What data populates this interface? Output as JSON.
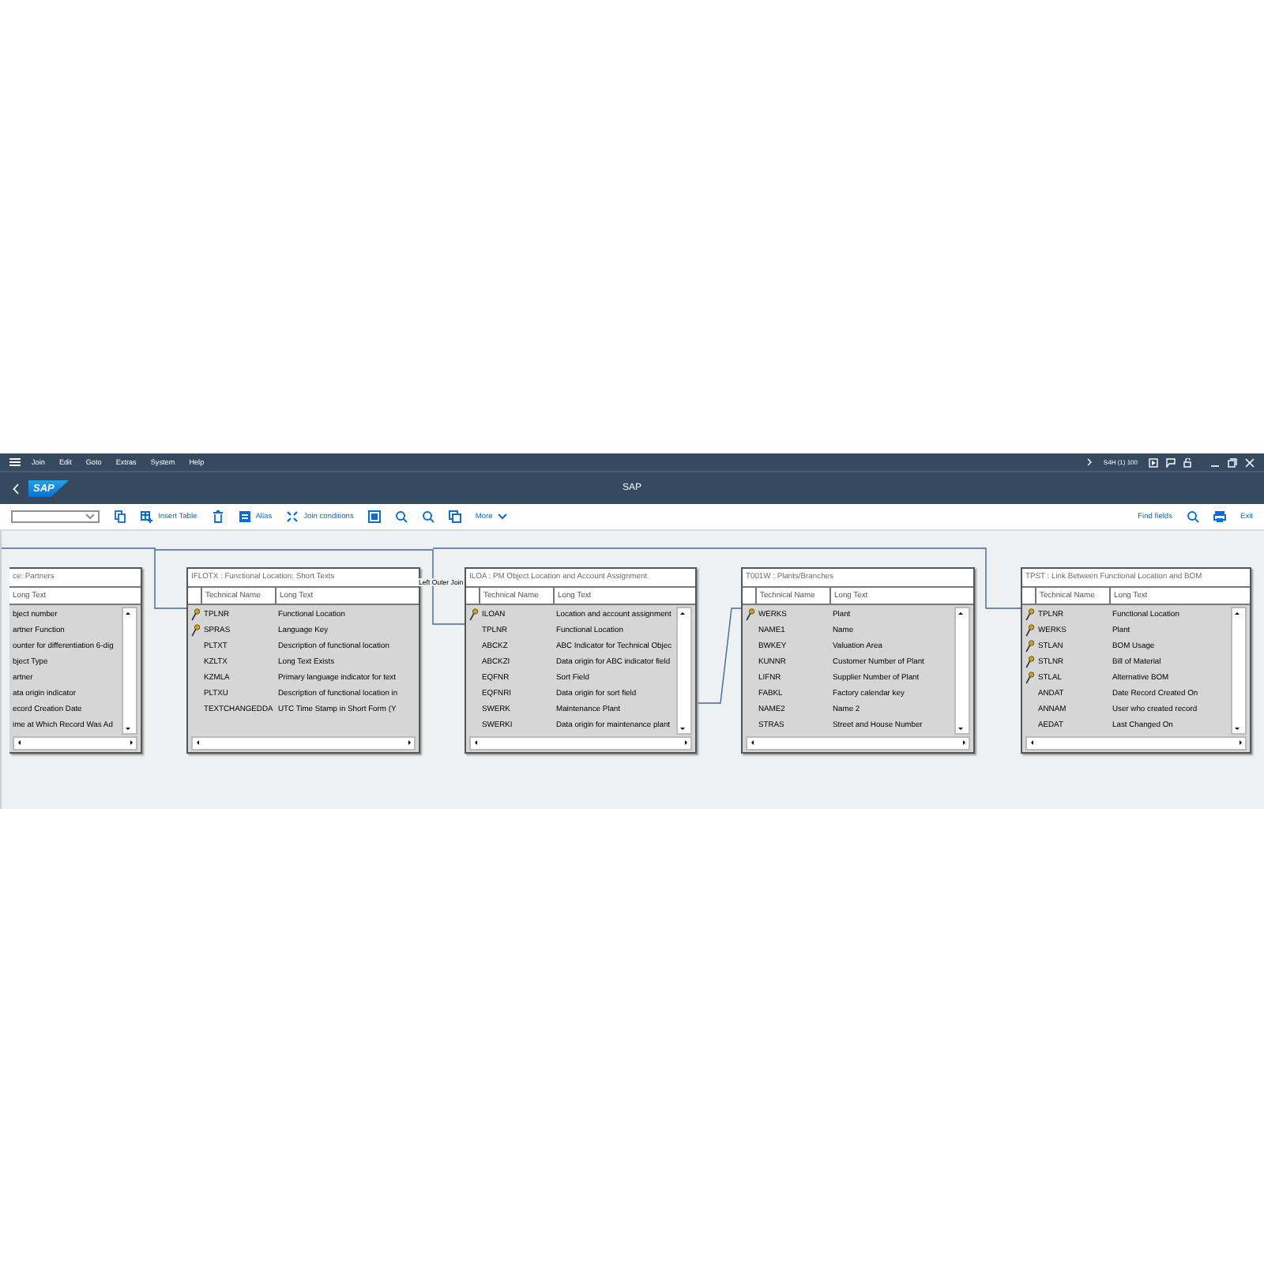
{
  "menu": [
    "Join",
    "Edit",
    "Goto",
    "Extras",
    "System",
    "Help"
  ],
  "system_info": "S4H (1) 100",
  "logo": "SAP",
  "title": "SAP",
  "toolbar": {
    "left": [
      {
        "kind": "dropdown"
      },
      {
        "kind": "icon"
      },
      {
        "kind": "button",
        "label": "Insert Table"
      },
      {
        "kind": "icon"
      },
      {
        "kind": "button",
        "label": "Alias"
      },
      {
        "kind": "button",
        "label": "Join conditions"
      },
      {
        "kind": "icon"
      },
      {
        "kind": "icon"
      },
      {
        "kind": "icon"
      },
      {
        "kind": "icon"
      },
      {
        "kind": "menu",
        "label": "More"
      }
    ],
    "right": [
      {
        "kind": "button",
        "label": "Find fields"
      },
      {
        "kind": "icon"
      },
      {
        "kind": "icon"
      },
      {
        "kind": "button",
        "label": "Exit"
      }
    ]
  },
  "join_label": "Left Outer Join",
  "tables": [
    {
      "title": "ce: Partners",
      "columns": [
        "Long Text"
      ],
      "rows": [
        {
          "cells": [
            "bject number"
          ]
        },
        {
          "cells": [
            "artner Function"
          ]
        },
        {
          "cells": [
            "ounter for differentiation 6-dig"
          ]
        },
        {
          "cells": [
            "bject Type"
          ]
        },
        {
          "cells": [
            "artner"
          ]
        },
        {
          "cells": [
            "ata origin indicator"
          ]
        },
        {
          "cells": [
            "ecord Creation Date"
          ]
        },
        {
          "cells": [
            "ime at Which Record Was Ad"
          ]
        }
      ]
    },
    {
      "title": "IFLOTX : Functional Location: Short Texts",
      "columns": [
        "Technical Name",
        "Long Text"
      ],
      "rows": [
        {
          "cells": [
            "TPLNR",
            "Functional Location"
          ],
          "key": true
        },
        {
          "cells": [
            "SPRAS",
            "Language Key"
          ],
          "key": true
        },
        {
          "cells": [
            "PLTXT",
            "Description of functional location"
          ],
          "key": false
        },
        {
          "cells": [
            "KZLTX",
            "Long Text Exists"
          ],
          "key": false
        },
        {
          "cells": [
            "KZMLA",
            "Primary language indicator for text"
          ],
          "key": false
        },
        {
          "cells": [
            "PLTXU",
            "Description of functional location in"
          ],
          "key": false
        },
        {
          "cells": [
            "TEXTCHANGEDDA",
            "UTC Time Stamp in Short Form (Y"
          ],
          "key": false
        }
      ]
    },
    {
      "title": "ILOA : PM Object Location and Account Assignment",
      "columns": [
        "Technical Name",
        "Long Text"
      ],
      "rows": [
        {
          "cells": [
            "ILOAN",
            "Location and account assignment"
          ],
          "key": true
        },
        {
          "cells": [
            "TPLNR",
            "Functional Location"
          ],
          "key": false
        },
        {
          "cells": [
            "ABCKZ",
            "ABC Indicator for Technical Objec"
          ],
          "key": false
        },
        {
          "cells": [
            "ABCKZI",
            "Data origin for ABC indicator field"
          ],
          "key": false
        },
        {
          "cells": [
            "EQFNR",
            "Sort Field"
          ],
          "key": false
        },
        {
          "cells": [
            "EQFNRI",
            "Data origin for sort field"
          ],
          "key": false
        },
        {
          "cells": [
            "SWERK",
            "Maintenance Plant"
          ],
          "key": false
        },
        {
          "cells": [
            "SWERKI",
            "Data origin for maintenance plant"
          ],
          "key": false
        }
      ]
    },
    {
      "title": "T001W : Plants/Branches",
      "columns": [
        "Technical Name",
        "Long Text"
      ],
      "rows": [
        {
          "cells": [
            "WERKS",
            "Plant"
          ],
          "key": true
        },
        {
          "cells": [
            "NAME1",
            "Name"
          ],
          "key": false
        },
        {
          "cells": [
            "BWKEY",
            "Valuation Area"
          ],
          "key": false
        },
        {
          "cells": [
            "KUNNR",
            "Customer Number of Plant"
          ],
          "key": false
        },
        {
          "cells": [
            "LIFNR",
            "Supplier Number of Plant"
          ],
          "key": false
        },
        {
          "cells": [
            "FABKL",
            "Factory calendar key"
          ],
          "key": false
        },
        {
          "cells": [
            "NAME2",
            "Name 2"
          ],
          "key": false
        },
        {
          "cells": [
            "STRAS",
            "Street and House Number"
          ],
          "key": false
        }
      ]
    },
    {
      "title": "TPST : Link Between Functional Location and BOM",
      "columns": [
        "Technical Name",
        "Long Text"
      ],
      "rows": [
        {
          "cells": [
            "TPLNR",
            "Functional Location"
          ],
          "key": true
        },
        {
          "cells": [
            "WERKS",
            "Plant"
          ],
          "key": true
        },
        {
          "cells": [
            "STLAN",
            "BOM Usage"
          ],
          "key": true
        },
        {
          "cells": [
            "STLNR",
            "Bill of Material"
          ],
          "key": true
        },
        {
          "cells": [
            "STLAL",
            "Alternative BOM"
          ],
          "key": true
        },
        {
          "cells": [
            "ANDAT",
            "Date Record Created On"
          ],
          "key": false
        },
        {
          "cells": [
            "ANNAM",
            "User who created record"
          ],
          "key": false
        },
        {
          "cells": [
            "AEDAT",
            "Last Changed On"
          ],
          "key": false
        }
      ]
    }
  ]
}
